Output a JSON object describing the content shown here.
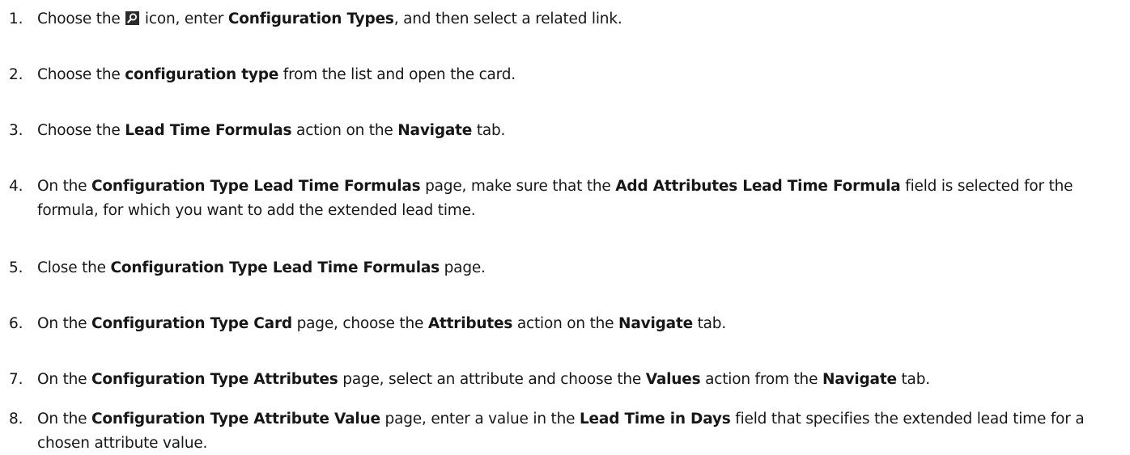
{
  "steps": [
    {
      "number": "1.",
      "parts": {
        "t1": "Choose the",
        "icon": "search-icon",
        "t2": " icon, enter ",
        "b1": "Configuration Types",
        "t3": ", and then select a related link."
      }
    },
    {
      "number": "2.",
      "parts": {
        "t1": "Choose the ",
        "b1": "configuration type",
        "t2": " from the list and open the card."
      }
    },
    {
      "number": "3.",
      "parts": {
        "t1": "Choose the ",
        "b1": "Lead Time Formulas",
        "t2": " action on the ",
        "b2": "Navigate",
        "t3": " tab."
      }
    },
    {
      "number": "4.",
      "parts": {
        "t1": "On the ",
        "b1": "Configuration Type Lead Time Formulas",
        "t2": " page, make sure that the ",
        "b2": "Add Attributes Lead Time Formula",
        "t3": " field is selected for the formula, for which you want to add the extended lead time."
      }
    },
    {
      "number": "5.",
      "parts": {
        "t1": "Close the ",
        "b1": "Configuration Type Lead Time Formulas",
        "t2": " page."
      }
    },
    {
      "number": "6.",
      "parts": {
        "t1": "On the ",
        "b1": "Configuration Type Card",
        "t2": " page, choose the ",
        "b2": "Attributes",
        "t3": " action on the ",
        "b3": "Navigate",
        "t4": " tab."
      }
    },
    {
      "number": "7.",
      "parts": {
        "t1": "On the ",
        "b1": "Configuration Type Attributes",
        "t2": " page, select an attribute and choose the ",
        "b2": "Values",
        "t3": " action from the ",
        "b3": "Navigate",
        "t4": " tab."
      }
    },
    {
      "number": "8.",
      "parts": {
        "t1": "On the ",
        "b1": "Configuration Type Attribute Value",
        "t2": " page, enter a value in the ",
        "b2": "Lead Time in Days",
        "t3": " field that specifies the extended lead time for a chosen attribute value."
      }
    }
  ]
}
